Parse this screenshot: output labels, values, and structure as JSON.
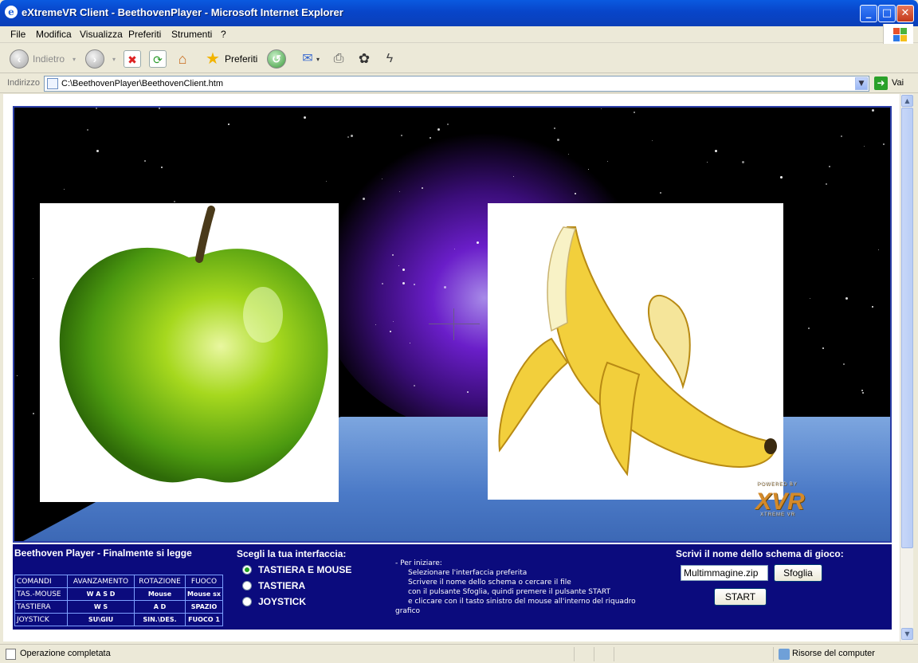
{
  "window": {
    "title": "eXtremeVR Client - BeethovenPlayer - Microsoft Internet Explorer",
    "controls": {
      "minimize": "_",
      "maximize": "□",
      "close": "✕"
    }
  },
  "menu": [
    "File",
    "Modifica",
    "Visualizza",
    "Preferiti",
    "Strumenti",
    "?"
  ],
  "toolbar": {
    "back_label": "Indietro",
    "favorites_label": "Preferiti",
    "icons": [
      "back-icon",
      "forward-icon",
      "stop-icon",
      "refresh-icon",
      "home-icon",
      "favorites-icon",
      "history-icon",
      "mail-icon",
      "print-icon",
      "settings-icon",
      "messenger-icon"
    ]
  },
  "address": {
    "label": "Indirizzo",
    "value": "C:\\BeethovenPlayer\\BeethovenClient.htm",
    "go_label": "Vai"
  },
  "scene": {
    "left_image": "green-apple",
    "right_image": "peeled-banana",
    "logo_top": "POWERED BY",
    "logo_main": "XVR",
    "logo_bottom": "XTREME VR"
  },
  "panel": {
    "title": "Beethoven Player - Finalmente si legge",
    "controls_table": {
      "headers": [
        "COMANDI",
        "AVANZAMENTO",
        "ROTAZIONE",
        "FUOCO"
      ],
      "rows": [
        [
          "TAS.-MOUSE",
          "W A S D",
          "Mouse",
          "Mouse sx"
        ],
        [
          "TASTIERA",
          "W S",
          "A D",
          "SPAZIO"
        ],
        [
          "JOYSTICK",
          "SU\\GIU",
          "SIN.\\DES.",
          "FUOCO 1"
        ]
      ]
    },
    "interface_title": "Scegli la tua interfaccia:",
    "interface_options": [
      {
        "label": "TASTIERA E MOUSE",
        "selected": true
      },
      {
        "label": "TASTIERA",
        "selected": false
      },
      {
        "label": "JOYSTICK",
        "selected": false
      }
    ],
    "instructions": [
      "- Per iniziare:",
      "Selezionare l'interfaccia preferita",
      "Scrivere il nome dello schema o cercare il file",
      "con il pulsante Sfoglia, quindi premere il pulsante START",
      "e cliccare con il tasto sinistro del mouse all'interno del riquadro",
      "grafico"
    ],
    "schema_title": "Scrivi il nome dello schema di gioco:",
    "schema_value": "Multimmagine.zip",
    "browse_label": "Sfoglia",
    "start_label": "START"
  },
  "status": {
    "text": "Operazione completata",
    "zone": "Risorse del computer"
  },
  "colors": {
    "titlebar": "#0a5ae0",
    "panel_bg": "#0b0b7d",
    "floor": "#5a86d2",
    "nebula": "#6a1ec9"
  }
}
